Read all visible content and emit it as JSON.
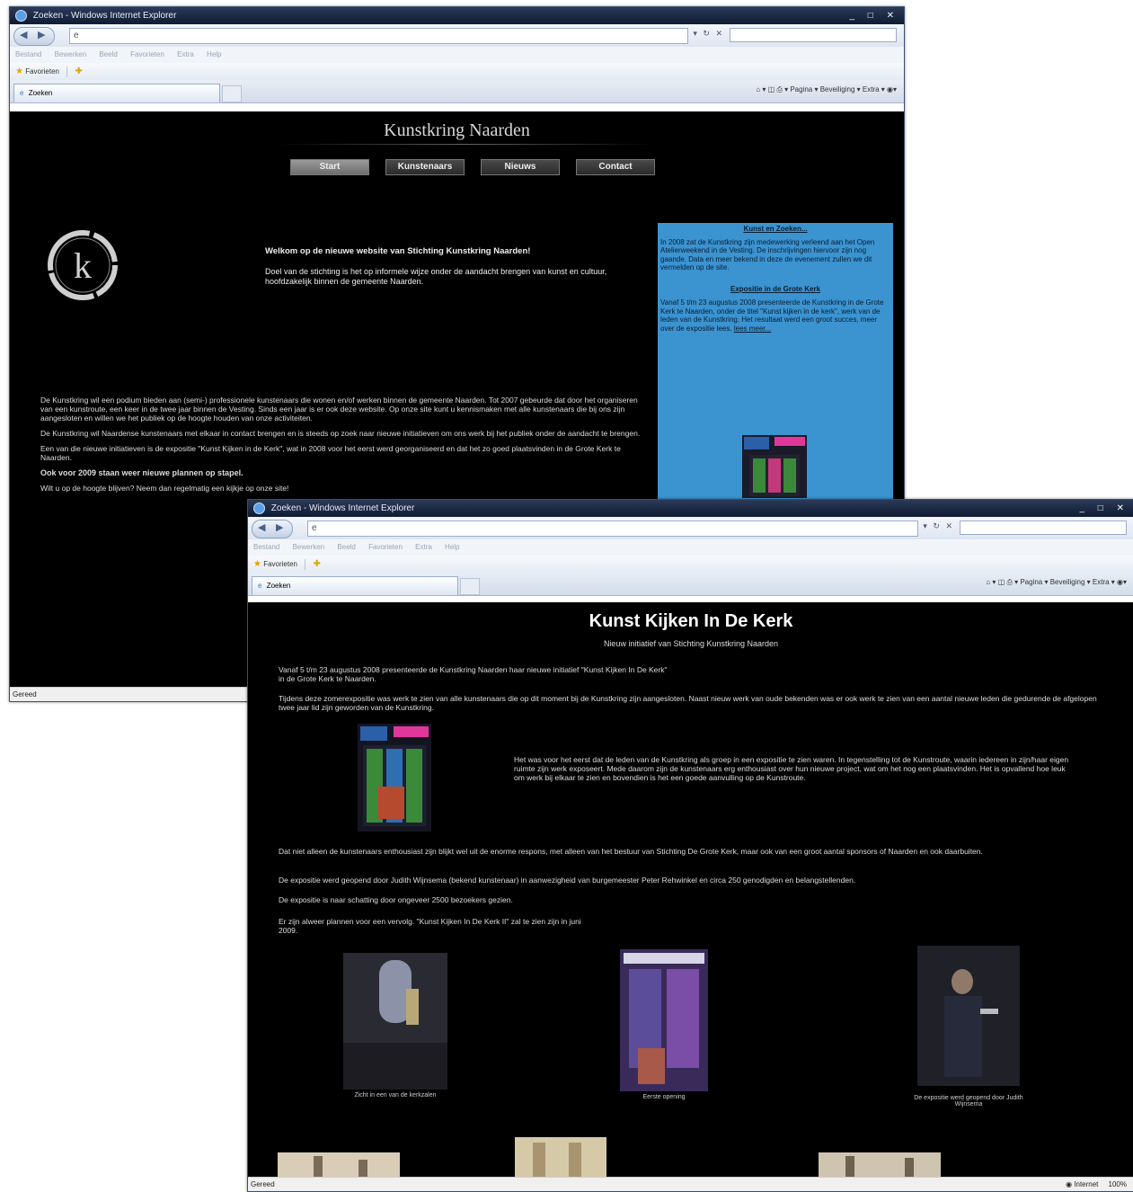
{
  "back_window": {
    "title": "Zoeken - Windows Internet Explorer",
    "menu": [
      "Bestand",
      "Bewerken",
      "Beeld",
      "Favorieten",
      "Extra",
      "Help"
    ],
    "favorites_label": "Favorieten",
    "tab_label": "Zoeken",
    "commandbar": "Pagina ▾   Beveiliging ▾   Extra ▾",
    "status": "Gereed",
    "page": {
      "site_title": "Kunstkring Naarden",
      "menu": [
        "Start",
        "Kunstenaars",
        "Nieuws",
        "Contact"
      ],
      "logo_letter": "k",
      "welcome_title": "Welkom op de nieuwe website van Stichting Kunstkring Naarden!",
      "welcome_text": "Doel van de stichting is het op informele wijze onder de aandacht brengen van kunst en cultuur, hoofdzakelijk binnen de gemeente Naarden.",
      "body_paragraphs": [
        "De Kunstkring wil een podium bieden aan (semi-) professionele kunstenaars die wonen en/of werken binnen de gemeente Naarden. Tot 2007 gebeurde dat door het organiseren van een kunstroute, een keer in de twee jaar binnen de Vesting. Sinds een jaar is er ook deze website. Op onze site kunt u kennismaken met alle kunstenaars die bij ons zijn aangesloten en willen we het publiek op de hoogte houden van onze activiteiten.",
        "De Kunstkring wil Naardense kunstenaars met elkaar in contact brengen en is steeds op zoek naar nieuwe initiatieven om ons werk bij het publiek onder de aandacht te brengen.",
        "Een van die nieuwe initiatieven is de expositie \"Kunst Kijken in de Kerk\", wat in 2008 voor het eerst werd georganiseerd en dat het zo goed plaatsvinden in de Grote Kerk te Naarden."
      ],
      "bold_line": "Ook voor 2009 staan weer nieuwe plannen op stapel.",
      "closing": "Wilt u op de hoogte blijven? Neem dan regelmatig een kijkje op onze site!",
      "sidebar": {
        "heading": "Kunst en Zoeken...",
        "intro": "In 2008 zat de Kunstkring zijn medewerking verleend aan het Open Atelierweekend in de Vesting. De inschrijvingen hiervoor zijn nog gaande. Data en meer bekend in deze de evenement zullen we dit vermelden op de site.",
        "heading2": "Expositie in de Grote Kerk",
        "text2": "Vanaf 5 t/m 23 augustus 2008 presenteerde de Kunstkring in de Grote Kerk te Naarden, onder de titel \"Kunst kijken in de kerk\", werk van de leden van de Kunstkring. Het resultaat werd een groot succes, meer over de expositie lees.",
        "link": "lees meer..."
      }
    }
  },
  "front_window": {
    "title": "Zoeken - Windows Internet Explorer",
    "menu": [
      "Bestand",
      "Bewerken",
      "Beeld",
      "Favorieten",
      "Extra",
      "Help"
    ],
    "favorites_label": "Favorieten",
    "tab_label": "Zoeken",
    "commandbar": "Pagina ▾   Beveiliging ▾   Extra ▾",
    "status": "Gereed",
    "zone": "Internet",
    "zoom": "100%",
    "page": {
      "title": "Kunst Kijken In De Kerk",
      "subtitle": "Nieuw initiatief van Stichting Kunstkring Naarden",
      "intro": "Vanaf 5 t/m 23 augustus 2008 presenteerde de Kunstkring Naarden haar nieuwe initiatief \"Kunst Kijken In De Kerk\" in de Grote Kerk te Naarden.",
      "p2": "Tijdens deze zomerexpositie was werk te zien van alle kunstenaars die op dit moment bij de Kunstkring zijn aangesloten. Naast nieuw werk van oude bekenden was er ook werk te zien van een aantal nieuwe leden die gedurende de afgelopen twee jaar lid zijn geworden van de Kunstkring.",
      "p3": "Het was voor het eerst dat de leden van de Kunstkring als groep in een expositie te zien waren. In tegenstelling tot de Kunstroute, waarin iedereen in zijn/haar eigen ruimte zijn werk exposeert. Mede daarom zijn de kunstenaars erg enthousiast over hun nieuwe project, wat om het nog een plaatsvinden. Het is opvallend hoe leuk om werk bij elkaar te zien en bovendien is het een goede aanvulling op de Kunstroute.",
      "p4": "Dat niet alleen de kunstenaars enthousiast zijn blijkt wel uit de enorme respons, met alleen van het bestuur van Stichting De Grote Kerk, maar ook van een groot aantal sponsors of Naarden en ook daarbuiten.",
      "p5": "De expositie werd geopend door Judith Wijnsema (bekend kunstenaar) in aanwezigheid van burgemeester Peter Rehwinkel en circa 250 genodigden en belangstellenden.",
      "p6": "De expositie is naar schatting door ongeveer 2500 bezoekers gezien.",
      "p7": "Er zijn alweer plannen voor een vervolg. \"Kunst Kijken In De Kerk II\" zal te zien zijn in juni 2009.",
      "captions": [
        "Zicht in een van de kerkzalen",
        "Eerste opening",
        "De expositie werd geopend door Judith Wijnsema"
      ]
    }
  },
  "colors": {
    "page_background": "#000000",
    "sidebar_blue": "#3b93d0",
    "poster_pink": "#e0389a",
    "poster_green": "#3b8a3a",
    "titlebar": "#1c2944"
  },
  "icons": [
    "ie-icon",
    "back-arrow-icon",
    "forward-arrow-icon",
    "refresh-icon",
    "stop-icon",
    "search-icon",
    "favorites-star-icon",
    "add-favorites-icon",
    "home-icon",
    "feeds-icon",
    "print-icon",
    "help-icon",
    "minimize-icon",
    "maximize-icon",
    "close-icon"
  ]
}
